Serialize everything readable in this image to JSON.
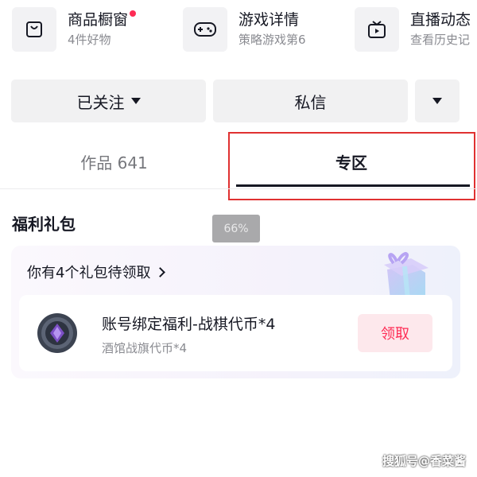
{
  "shortcuts": [
    {
      "title": "商品橱窗",
      "sub": "4件好物",
      "icon": "shopping-bag-icon",
      "has_dot": true
    },
    {
      "title": "游戏详情",
      "sub": "策略游戏第6",
      "icon": "gamepad-icon"
    },
    {
      "title": "直播动态",
      "sub": "查看历史记",
      "icon": "tv-icon"
    }
  ],
  "actions": {
    "follow_label": "已关注",
    "message_label": "私信"
  },
  "tabs": {
    "works_label": "作品 641",
    "zone_label": "专区"
  },
  "zoom_level": "66%",
  "welfare": {
    "section_title": "福利礼包",
    "card_header": "你有4个礼包待领取",
    "item": {
      "name": "账号绑定福利-战棋代币*4",
      "sub": "酒馆战旗代币*4",
      "claim_label": "领取"
    }
  },
  "watermark": "搜狐号@香菜酱",
  "colors": {
    "accent": "#fe2c55",
    "highlight_box": "#e03131",
    "claim_bg": "#fde8ec"
  }
}
